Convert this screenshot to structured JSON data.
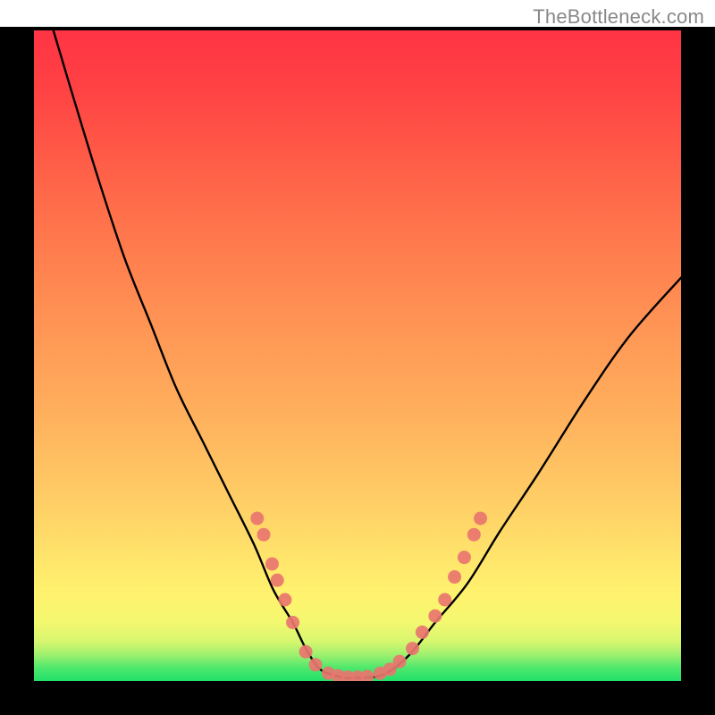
{
  "watermark": "TheBottleneck.com",
  "chart_data": {
    "type": "line",
    "title": "",
    "xlabel": "",
    "ylabel": "",
    "xlim": [
      0,
      100
    ],
    "ylim": [
      0,
      100
    ],
    "grid": false,
    "curve_left": {
      "name": "left-branch",
      "x": [
        3,
        6,
        10,
        14,
        18,
        22,
        26,
        30,
        34,
        37,
        40,
        42,
        44,
        46
      ],
      "y": [
        100,
        90,
        77,
        65,
        55,
        45,
        37,
        29,
        21,
        14,
        9,
        5,
        2,
        1
      ]
    },
    "curve_flat": {
      "name": "valley",
      "x": [
        46,
        48,
        50,
        54
      ],
      "y": [
        1,
        0.5,
        0.5,
        1
      ]
    },
    "curve_right": {
      "name": "right-branch",
      "x": [
        54,
        58,
        62,
        67,
        72,
        78,
        85,
        92,
        100
      ],
      "y": [
        1,
        4,
        9,
        15,
        23,
        32,
        43,
        53,
        62
      ]
    },
    "points": [
      {
        "x": 34.5,
        "y": 25.0
      },
      {
        "x": 35.5,
        "y": 22.5
      },
      {
        "x": 36.8,
        "y": 18.0
      },
      {
        "x": 37.6,
        "y": 15.5
      },
      {
        "x": 38.8,
        "y": 12.5
      },
      {
        "x": 40.0,
        "y": 9.0
      },
      {
        "x": 42.0,
        "y": 4.5
      },
      {
        "x": 43.5,
        "y": 2.5
      },
      {
        "x": 45.5,
        "y": 1.2
      },
      {
        "x": 47.0,
        "y": 0.8
      },
      {
        "x": 48.5,
        "y": 0.6
      },
      {
        "x": 50.0,
        "y": 0.6
      },
      {
        "x": 51.5,
        "y": 0.7
      },
      {
        "x": 53.5,
        "y": 1.2
      },
      {
        "x": 55.0,
        "y": 1.8
      },
      {
        "x": 56.5,
        "y": 3.0
      },
      {
        "x": 58.5,
        "y": 5.0
      },
      {
        "x": 60.0,
        "y": 7.5
      },
      {
        "x": 62.0,
        "y": 10.0
      },
      {
        "x": 63.5,
        "y": 12.5
      },
      {
        "x": 65.0,
        "y": 16.0
      },
      {
        "x": 66.5,
        "y": 19.0
      },
      {
        "x": 68.0,
        "y": 22.5
      },
      {
        "x": 69.0,
        "y": 25.0
      }
    ],
    "annotations": []
  }
}
